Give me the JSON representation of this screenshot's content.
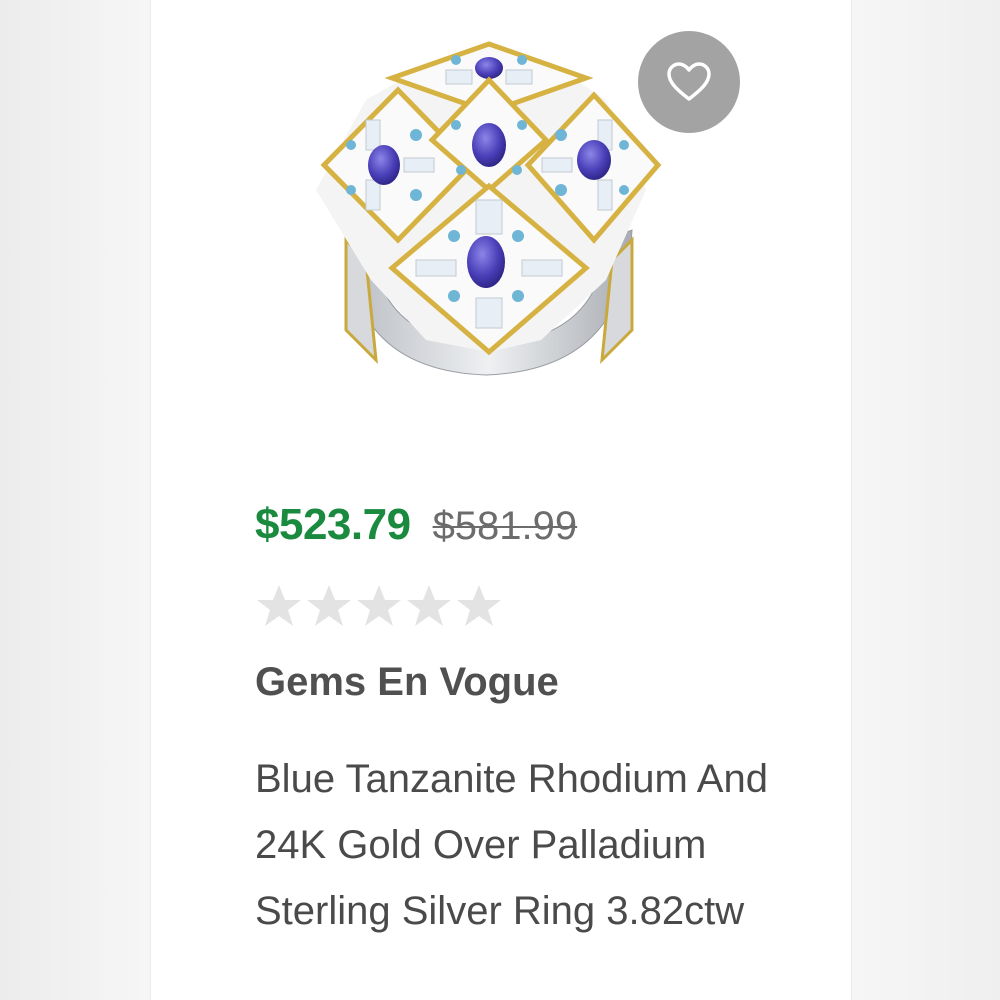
{
  "product": {
    "sale_price": "$523.79",
    "original_price": "$581.99",
    "rating": {
      "stars_filled": 0,
      "stars_total": 5
    },
    "brand": "Gems En Vogue",
    "description": "Blue Tanzanite Rhodium And 24K Gold Over Palladium Sterling Silver Ring 3.82ctw"
  },
  "icons": {
    "favorite": "heart-outline-icon",
    "prev": "chevron-left-icon",
    "star": "star-icon"
  },
  "colors": {
    "sale_price": "#1a8a3f",
    "original_price": "#6c6c6c",
    "star_empty": "#e3e3e3",
    "favorite_bg": "#a3a3a3",
    "brand": "#505050",
    "description": "#4a4a4a"
  }
}
